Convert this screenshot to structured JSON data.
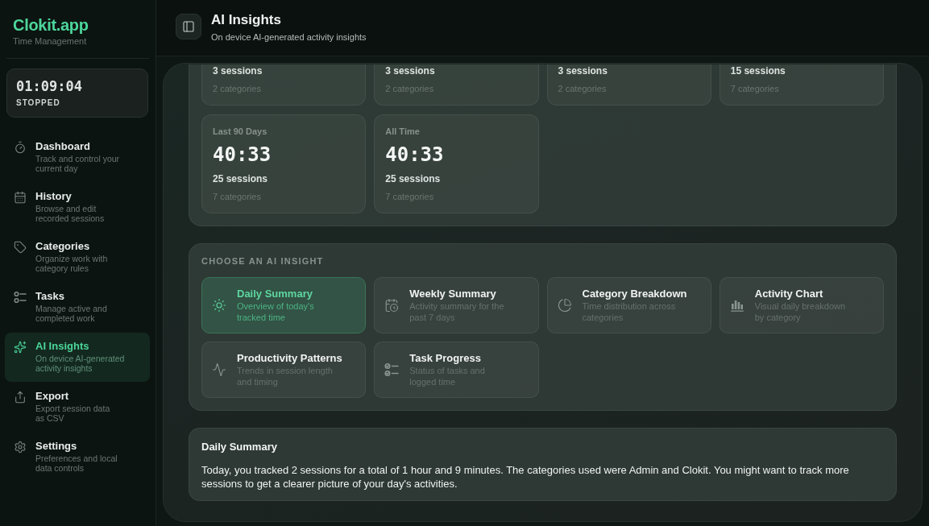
{
  "sidebar": {
    "logo": "Clokit.app",
    "tagline": "Time Management",
    "timer": {
      "time": "01:09:04",
      "status": "STOPPED"
    },
    "items": [
      {
        "title": "Dashboard",
        "subtitle": "Track and control your current day",
        "selected": false
      },
      {
        "title": "History",
        "subtitle": "Browse and edit recorded sessions",
        "selected": false
      },
      {
        "title": "Categories",
        "subtitle": "Organize work with category rules",
        "selected": false
      },
      {
        "title": "Tasks",
        "subtitle": "Manage active and completed work",
        "selected": false
      },
      {
        "title": "AI Insights",
        "subtitle": "On device AI-generated activity insights",
        "selected": true
      },
      {
        "title": "Export",
        "subtitle": "Export session data as CSV",
        "selected": false
      },
      {
        "title": "Settings",
        "subtitle": "Preferences and local data controls",
        "selected": false
      }
    ]
  },
  "header": {
    "title": "AI Insights",
    "subtitle": "On device AI-generated activity insights"
  },
  "stats": [
    {
      "sessions": "3 sessions",
      "categories": "2 categories"
    },
    {
      "sessions": "3 sessions",
      "categories": "2 categories"
    },
    {
      "sessions": "3 sessions",
      "categories": "2 categories"
    },
    {
      "sessions": "15 sessions",
      "categories": "7 categories"
    },
    {
      "label": "Last 90 Days",
      "time": "40:33",
      "sessions": "25 sessions",
      "categories": "7 categories"
    },
    {
      "label": "All Time",
      "time": "40:33",
      "sessions": "25 sessions",
      "categories": "7 categories"
    }
  ],
  "insights": {
    "heading": "CHOOSE AN AI INSIGHT",
    "options": [
      {
        "title": "Daily Summary",
        "description": "Overview of today's tracked time",
        "selected": true
      },
      {
        "title": "Weekly Summary",
        "description": "Activity summary for the past 7 days",
        "selected": false
      },
      {
        "title": "Category Breakdown",
        "description": "Time distribution across categories",
        "selected": false
      },
      {
        "title": "Activity Chart",
        "description": "Visual daily breakdown by category",
        "selected": false
      },
      {
        "title": "Productivity Patterns",
        "description": "Trends in session length and timing",
        "selected": false
      },
      {
        "title": "Task Progress",
        "description": "Status of tasks and logged time",
        "selected": false
      }
    ]
  },
  "summary": {
    "title": "Daily Summary",
    "text": "Today, you tracked 2 sessions for a total of 1 hour and 9 minutes. The categories used were Admin and Clokit. You might want to track more sessions to get a clearer picture of your day's activities."
  }
}
